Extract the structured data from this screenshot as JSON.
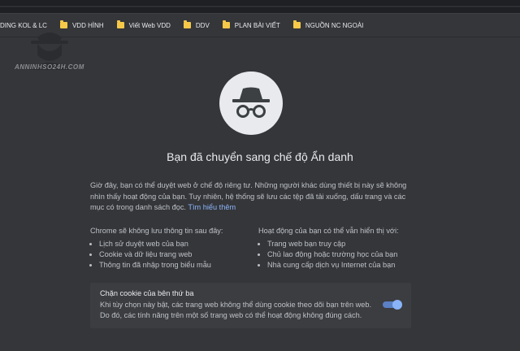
{
  "bookmarks": [
    {
      "label": "DING KOL & LC",
      "icon": "folder-icon"
    },
    {
      "label": "VDD HÌNH",
      "icon": "folder-icon"
    },
    {
      "label": "Viết Web VDD",
      "icon": "folder-icon"
    },
    {
      "label": "DDV",
      "icon": "folder-icon"
    },
    {
      "label": "PLAN BÀI VIẾT",
      "icon": "folder-icon"
    },
    {
      "label": "NGUỒN NC NGOÀI",
      "icon": "folder-icon"
    }
  ],
  "watermark": {
    "text": "ANNINHSO24H.COM"
  },
  "incognito": {
    "title": "Bạn đã chuyển sang chế độ Ẩn danh",
    "intro": "Giờ đây, bạn có thể duyệt web ở chế độ riêng tư. Những người khác dùng thiết bị này sẽ không nhìn thấy hoạt động của bạn. Tuy nhiên, hệ thống sẽ lưu các tệp đã tải xuống, dấu trang và các mục có trong danh sách đọc.",
    "learn_more": "Tìm hiểu thêm",
    "not_saved_heading": "Chrome sẽ không lưu thông tin sau đây:",
    "not_saved_items": [
      "Lịch sử duyệt web của bạn",
      "Cookie và dữ liệu trang web",
      "Thông tin đã nhập trong biểu mẫu"
    ],
    "visible_heading": "Hoạt động của bạn có thể vẫn hiển thị với:",
    "visible_items": [
      "Trang web bạn truy cập",
      "Chủ lao động hoặc trường học của bạn",
      "Nhà cung cấp dịch vụ Internet của bạn"
    ],
    "cookie_title": "Chặn cookie của bên thứ ba",
    "cookie_desc": "Khi tùy chọn này bật, các trang web không thể dùng cookie theo dõi bạn trên web. Do đó, các tính năng trên một số trang web có thể hoạt động không đúng cách.",
    "cookie_toggle_on": true
  },
  "colors": {
    "background": "#35363a",
    "accent": "#8ab4f8",
    "folder": "#f7c948"
  }
}
